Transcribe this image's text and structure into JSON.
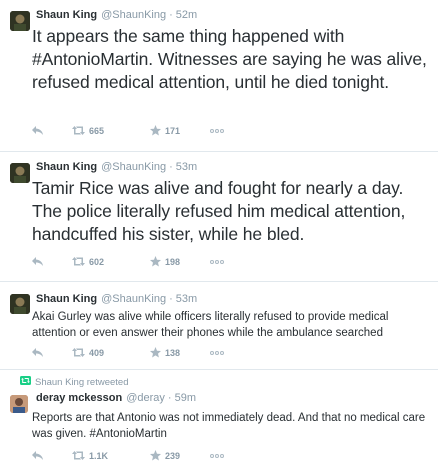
{
  "tweets": [
    {
      "name": "Shaun King",
      "handle": "@ShaunKing",
      "time": "52m",
      "text": "It appears the same thing happened with #AntonioMartin. Witnesses are saying he was alive, refused medical attention, until he died tonight.",
      "retweets": "665",
      "favorites": "171"
    },
    {
      "name": "Shaun King",
      "handle": "@ShaunKing",
      "time": "53m",
      "text": "Tamir Rice was alive and fought for nearly a day. The police literally refused him medical attention, handcuffed his sister, while he bled.",
      "retweets": "602",
      "favorites": "198"
    },
    {
      "name": "Shaun King",
      "handle": "@ShaunKing",
      "time": "53m",
      "text": "Akai Gurley was alive while officers literally refused to provide medical attention or even answer their phones while the ambulance searched",
      "retweets": "409",
      "favorites": "138"
    },
    {
      "retweeted_by": "Shaun King retweeted",
      "name": "deray mckesson",
      "handle": "@deray",
      "time": "59m",
      "text": "Reports are that Antonio was not immediately dead. And that no medical care was given. #AntonioMartin",
      "retweets": "1.1K",
      "favorites": "239"
    }
  ],
  "separator": "·",
  "colors": {
    "text": "#292f33",
    "meta": "#8899a6",
    "divider": "#e1e8ed",
    "retweet_green": "#19cf86"
  },
  "icons": {
    "reply": "reply-icon",
    "retweet": "retweet-icon",
    "favorite": "star-icon",
    "more": "more-icon"
  }
}
